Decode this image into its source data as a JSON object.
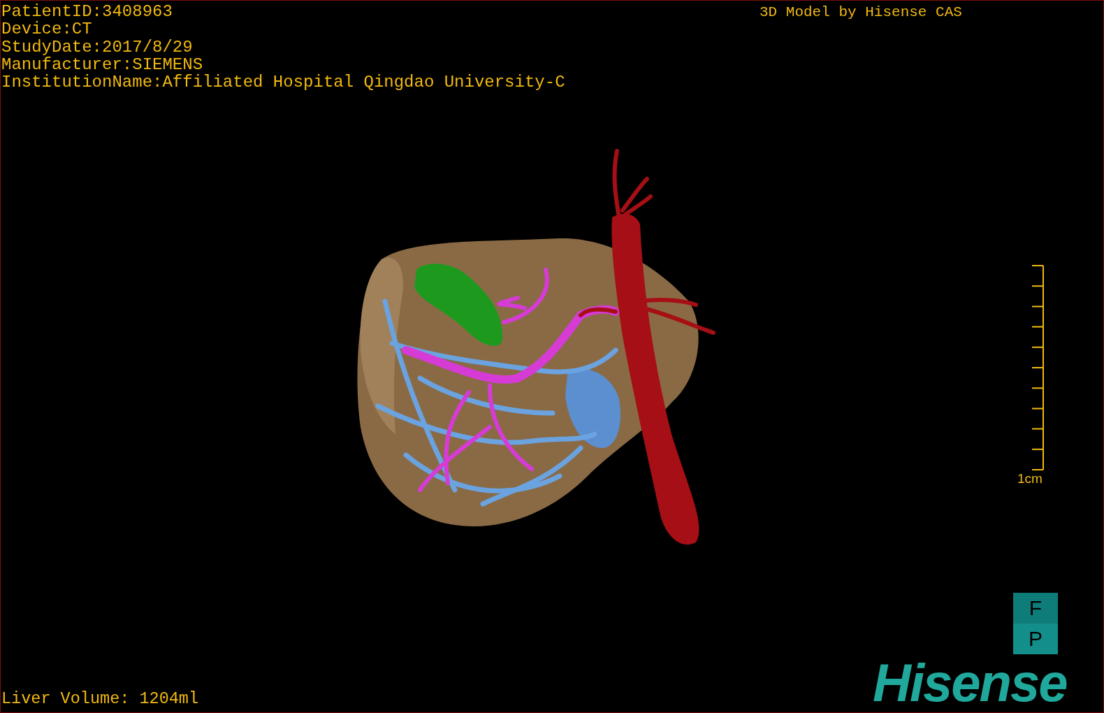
{
  "patient_info": [
    "PatientID:3408963",
    "Device:CT",
    "StudyDate:2017/8/29",
    "Manufacturer:SIEMENS",
    "InstitutionName:Affiliated Hospital Qingdao University-C"
  ],
  "model_title": "3D Model by Hisense CAS",
  "scale_label": "1cm",
  "orientation_buttons": [
    "F",
    "P"
  ],
  "logo": "Hisense",
  "volume": "Liver Volume: 1204ml"
}
